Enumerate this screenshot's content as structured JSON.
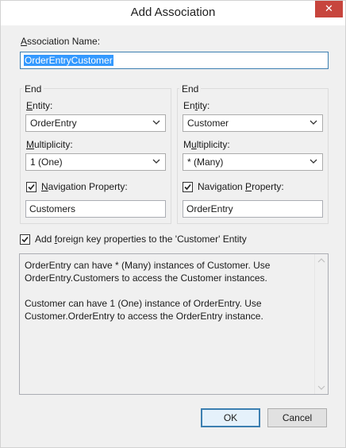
{
  "window": {
    "title": "Add Association",
    "close_glyph": "✕"
  },
  "association_name": {
    "label_pre": "",
    "label_mnemonic": "A",
    "label_post": "ssociation Name:",
    "value": "OrderEntryCustomer"
  },
  "end1": {
    "caption": "End",
    "entity_label_pre": "",
    "entity_label_mnemonic": "E",
    "entity_label_post": "ntity:",
    "entity_value": "OrderEntry",
    "multiplicity_label_pre": "",
    "multiplicity_label_mnemonic": "M",
    "multiplicity_label_post": "ultiplicity:",
    "multiplicity_value": "1 (One)",
    "nav_checked": true,
    "nav_label_pre": "",
    "nav_label_mnemonic": "N",
    "nav_label_post": "avigation Property:",
    "nav_value": "Customers"
  },
  "end2": {
    "caption": "End",
    "entity_label_pre": "En",
    "entity_label_mnemonic": "t",
    "entity_label_post": "ity:",
    "entity_value": "Customer",
    "multiplicity_label_pre": "M",
    "multiplicity_label_mnemonic": "u",
    "multiplicity_label_post": "ltiplicity:",
    "multiplicity_value": "* (Many)",
    "nav_checked": true,
    "nav_label_pre": "Navigation ",
    "nav_label_mnemonic": "P",
    "nav_label_post": "roperty:",
    "nav_value": "OrderEntry"
  },
  "foreign_key": {
    "checked": true,
    "label_pre": "Add ",
    "label_mnemonic": "f",
    "label_post": "oreign key properties to the 'Customer' Entity"
  },
  "summary": {
    "line1": "OrderEntry can have * (Many) instances of Customer. Use",
    "line2": "OrderEntry.Customers to access the Customer instances.",
    "line3": "Customer can have 1 (One) instance of OrderEntry. Use",
    "line4": "Customer.OrderEntry to access the OrderEntry instance."
  },
  "buttons": {
    "ok": "OK",
    "cancel": "Cancel"
  }
}
